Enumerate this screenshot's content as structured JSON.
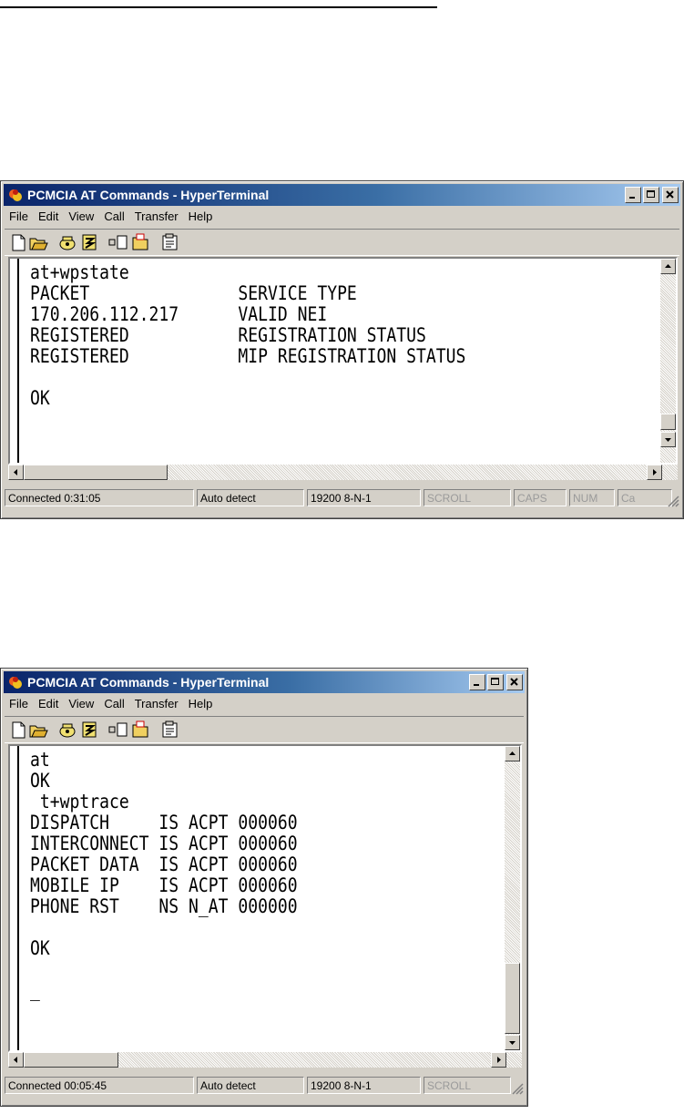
{
  "windows": [
    {
      "title": "PCMCIA AT Commands - HyperTerminal",
      "menu": [
        "File",
        "Edit",
        "View",
        "Call",
        "Transfer",
        "Help"
      ],
      "lines": [
        "at+wpstate",
        "PACKET               SERVICE TYPE",
        "170.206.112.217      VALID NEI",
        "REGISTERED           REGISTRATION STATUS",
        "REGISTERED           MIP REGISTRATION STATUS",
        "",
        "OK"
      ],
      "status": [
        "Connected 0:31:05",
        "Auto detect",
        "19200 8-N-1",
        "SCROLL",
        "CAPS",
        "NUM",
        "Ca"
      ]
    },
    {
      "title": "PCMCIA AT Commands - HyperTerminal",
      "menu": [
        "File",
        "Edit",
        "View",
        "Call",
        "Transfer",
        "Help"
      ],
      "lines": [
        "at",
        "OK",
        " t+wptrace",
        "DISPATCH     IS ACPT 000060",
        "INTERCONNECT IS ACPT 000060",
        "PACKET DATA  IS ACPT 000060",
        "MOBILE IP    IS ACPT 000060",
        "PHONE RST    NS N_AT 000000",
        "",
        "OK",
        "",
        "_"
      ],
      "status": [
        "Connected 00:05:45",
        "Auto detect",
        "19200 8-N-1",
        "SCROLL"
      ]
    }
  ],
  "colors": {
    "titlebar_start": "#0a246a",
    "titlebar_end": "#a6caf0",
    "chrome": "#d4d0c8"
  }
}
